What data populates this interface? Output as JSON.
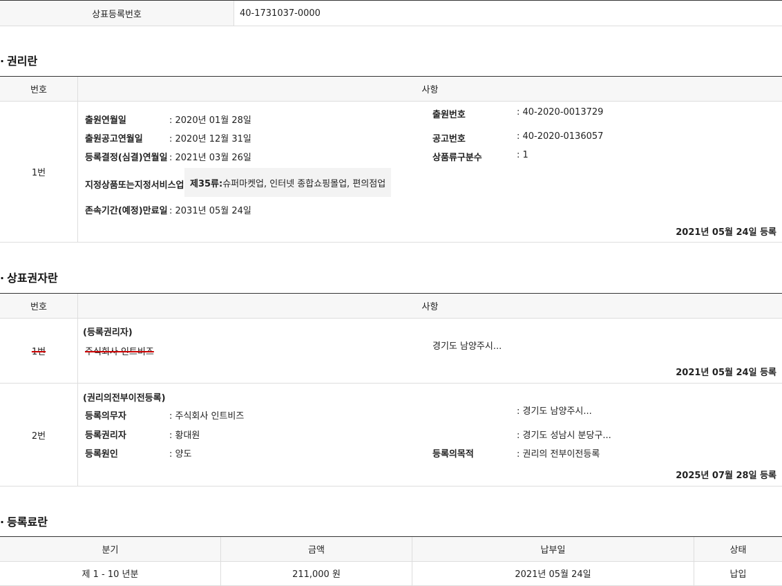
{
  "registration": {
    "label": "상표등록번호",
    "value": "40-1731037-0000"
  },
  "rights": {
    "title": "권리란",
    "col_num": "번호",
    "col_detail": "사항",
    "row_num": "1번",
    "labels": {
      "filing_date": "출원연월일",
      "pub_date": "출원공고연월일",
      "reg_decision": "등록결정(심결)연월일",
      "designated": "지정상품또는지정서비스업",
      "expiry": "존속기간(예정)만료일",
      "app_no": "출원번호",
      "notice_no": "공고번호",
      "class_count": "상품류구분수"
    },
    "values": {
      "filing_date": ": 2020년 01월 28일",
      "pub_date": ": 2020년 12월 31일",
      "reg_decision": ": 2021년 03월 26일",
      "designated_class": "제35류:",
      "designated_desc": " 슈퍼마켓업, 인터넷 종합쇼핑몰업, 편의점업",
      "expiry": ": 2031년 05월 24일",
      "app_no": ": 40-2020-0013729",
      "notice_no": ": 40-2020-0136057",
      "class_count": ": 1"
    },
    "reg_stamp": "2021년 05월 24일 등록"
  },
  "owners": {
    "title": "상표권자란",
    "col_num": "번호",
    "col_detail": "사항",
    "row1": {
      "num": "1번",
      "type": "(등록권리자)",
      "name": "주식회사 인트비즈",
      "address": "경기도 남양주시...",
      "stamp": "2021년 05월 24일 등록"
    },
    "row2": {
      "num": "2번",
      "type": "(권리의전부이전등록)",
      "obligor_label": "등록의무자",
      "obligor": ": 주식회사 인트비즈",
      "obligor_addr": ": 경기도 남양주시...",
      "holder_label": "등록권리자",
      "holder": ": 황대원",
      "holder_addr": ": 경기도 성남시 분당구...",
      "cause_label": "등록원인",
      "cause": ": 양도",
      "purpose_label": "등록의목적",
      "purpose": ": 권리의 전부이전등록",
      "stamp": "2025년 07월 28일 등록"
    }
  },
  "fees": {
    "title": "등록료란",
    "headers": [
      "분기",
      "금액",
      "납부일",
      "상태"
    ],
    "row": [
      "제 1 - 10 년분",
      "211,000 원",
      "2021년 05월 24일",
      "납입"
    ]
  }
}
